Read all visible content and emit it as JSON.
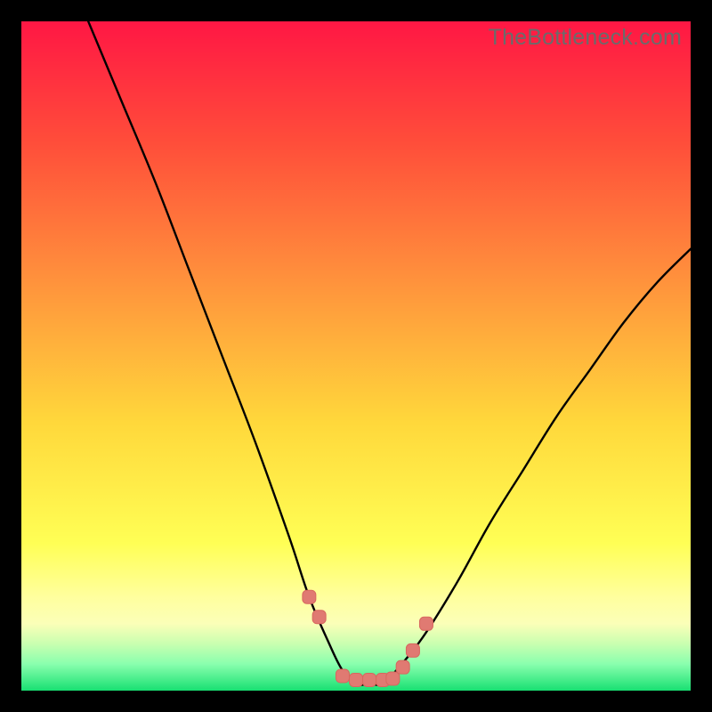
{
  "watermark": "TheBottleneck.com",
  "colors": {
    "black": "#000000",
    "curve": "#000000",
    "marker_fill": "#e07a72",
    "marker_stroke": "#d8675f",
    "grad_top": "#ff1744",
    "grad_orange": "#ff8a3c",
    "grad_yellow": "#ffe63b",
    "grad_lightyellow": "#ffff9e",
    "grad_mint": "#6fffa8",
    "grad_green": "#18e072"
  },
  "chart_data": {
    "type": "line",
    "title": "",
    "xlabel": "",
    "ylabel": "",
    "xlim": [
      0,
      100
    ],
    "ylim": [
      0,
      100
    ],
    "series": [
      {
        "name": "bottleneck-curve",
        "x": [
          10,
          15,
          20,
          25,
          30,
          35,
          40,
          43,
          46,
          48,
          50,
          52,
          54,
          56,
          60,
          65,
          70,
          75,
          80,
          85,
          90,
          95,
          100
        ],
        "y": [
          100,
          88,
          76,
          63,
          50,
          37,
          23,
          14,
          7,
          3,
          1,
          1,
          1,
          3,
          8,
          16,
          25,
          33,
          41,
          48,
          55,
          61,
          66
        ]
      }
    ],
    "markers": {
      "name": "highlight-points",
      "x": [
        43,
        44.5,
        48,
        50,
        52,
        54,
        55.5,
        57,
        58.5,
        60.5
      ],
      "y": [
        14,
        11,
        2.2,
        1.6,
        1.6,
        1.6,
        1.8,
        3.5,
        6,
        10
      ]
    },
    "gradient_stops": [
      {
        "offset": 0.0,
        "color": "#ff1744"
      },
      {
        "offset": 0.18,
        "color": "#ff4d3a"
      },
      {
        "offset": 0.4,
        "color": "#ff963c"
      },
      {
        "offset": 0.6,
        "color": "#ffd83b"
      },
      {
        "offset": 0.78,
        "color": "#ffff55"
      },
      {
        "offset": 0.86,
        "color": "#ffff9e"
      },
      {
        "offset": 0.9,
        "color": "#fbffb8"
      },
      {
        "offset": 0.93,
        "color": "#c9ffb0"
      },
      {
        "offset": 0.96,
        "color": "#8affae"
      },
      {
        "offset": 1.0,
        "color": "#18e072"
      }
    ]
  }
}
